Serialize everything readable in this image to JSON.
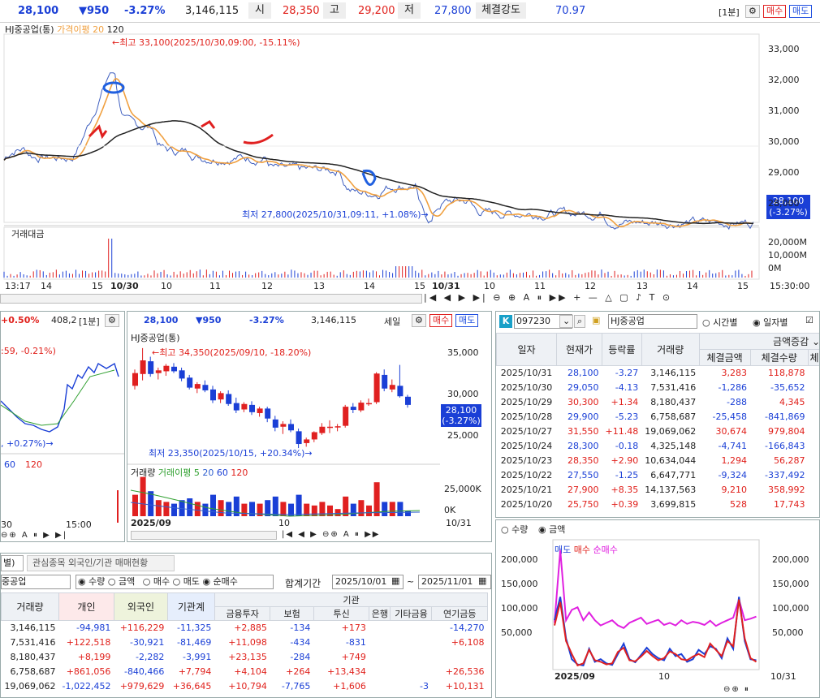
{
  "top": {
    "price": "28,100",
    "change": "▼950",
    "rate": "-3.27%",
    "volume": "3,146,115",
    "open_label": "시",
    "open": "28,350",
    "high_label": "고",
    "high": "29,200",
    "low_label": "저",
    "low": "27,800",
    "strength_label": "체결강도",
    "strength": "70.97",
    "interval": "[1분]",
    "sell": "매수",
    "buy": "매도"
  },
  "main_chart": {
    "title": "HJ중공업(통)",
    "ma_label": "가격이평",
    "ma1": "20",
    "ma2": "120",
    "high_annot": "←최고 33,100(2025/10/30,09:00, -15.11%)",
    "low_annot": "최저 27,800(2025/10/31,09:11, +1.08%)→",
    "price_box": "28,100",
    "price_box_pct": "(-3.27%)",
    "y_ticks": [
      "33,000",
      "32,000",
      "31,000",
      "30,000",
      "29,000",
      "28,000"
    ],
    "vol_title": "거래대금",
    "vol_ticks": [
      "20,000M",
      "10,000M",
      "0M"
    ],
    "x_ticks": [
      "13:17",
      "14",
      "15",
      "10/30",
      "10",
      "11",
      "12",
      "13",
      "14",
      "15",
      "10/31",
      "10",
      "11",
      "12",
      "13",
      "14",
      "15"
    ],
    "time_right": "15:30:00"
  },
  "mini_left": {
    "rate": "+0.50%",
    "value": "408,2",
    "interval": "[1분]",
    "annot1": ":59, -0.21%)",
    "annot2": ", +0.27%)→",
    "ticks": [
      "60",
      "120"
    ],
    "x_ticks": [
      "30",
      "15:00"
    ]
  },
  "daily_chart": {
    "price": "28,100",
    "change": "▼950",
    "rate": "-3.27%",
    "volume": "3,146,115",
    "period": "세일",
    "sell": "매수",
    "buy": "매도",
    "title": "HJ중공업(통)",
    "high_annot": "←최고 34,350(2025/09/10, -18.20%)",
    "low_annot": "최저 23,350(2025/10/15, +20.34%)→",
    "y_ticks": [
      "35,000",
      "30,000",
      "25,000"
    ],
    "price_box": "28,100",
    "price_box_pct": "(-3.27%)",
    "vol_title": "거래량",
    "vol_ma_label": "거래이평",
    "vol_ma": [
      "5",
      "20",
      "60",
      "120"
    ],
    "vol_ticks": [
      "25,000K",
      "0K"
    ],
    "x_left": "2025/09",
    "x_mid": "10",
    "x_right": "10/31"
  },
  "stock_panel": {
    "code": "097230",
    "name": "HJ중공업",
    "radio_time": "시간별",
    "radio_day": "일자별",
    "headers": [
      "일자",
      "현재가",
      "등락률",
      "거래량"
    ],
    "sub_header_top": "금액증감",
    "sub_headers": [
      "체결금액",
      "체결수량",
      "체"
    ],
    "rows": [
      [
        "2025/10/31",
        "28,100",
        "-3.27",
        "3,146,115",
        "3,283",
        "118,878"
      ],
      [
        "2025/10/30",
        "29,050",
        "-4.13",
        "7,531,416",
        "-1,286",
        "-35,652"
      ],
      [
        "2025/10/29",
        "30,300",
        "+1.34",
        "8,180,437",
        "-288",
        "4,345"
      ],
      [
        "2025/10/28",
        "29,900",
        "-5.23",
        "6,758,687",
        "-25,458",
        "-841,869"
      ],
      [
        "2025/10/27",
        "31,550",
        "+11.48",
        "19,069,062",
        "30,674",
        "979,804"
      ],
      [
        "2025/10/24",
        "28,300",
        "-0.18",
        "4,325,148",
        "-4,741",
        "-166,843"
      ],
      [
        "2025/10/23",
        "28,350",
        "+2.90",
        "10,634,044",
        "1,294",
        "56,287"
      ],
      [
        "2025/10/22",
        "27,550",
        "-1.25",
        "6,647,771",
        "-9,324",
        "-337,492"
      ],
      [
        "2025/10/21",
        "27,900",
        "+8.35",
        "14,137,563",
        "9,210",
        "358,992"
      ],
      [
        "2025/10/20",
        "25,750",
        "+0.39",
        "3,699,815",
        "528",
        "17,743"
      ]
    ]
  },
  "flow_chart": {
    "radio_qty": "수량",
    "radio_amt": "금액",
    "legend": [
      "매도",
      "매수",
      "순매수"
    ],
    "y_ticks": [
      "200,000",
      "150,000",
      "100,000",
      "50,000"
    ],
    "x_left": "2025/09",
    "x_mid": "10",
    "x_right": "10/31"
  },
  "investor": {
    "tab1": "별)",
    "tab2": "관심종목 외국인/기관 매매현황",
    "name": "중공업",
    "radios": [
      "수량",
      "금액",
      "매수",
      "매도",
      "순매수"
    ],
    "period_label": "합계기간",
    "date_from": "2025/10/01",
    "date_to": "2025/11/01",
    "group_header": "기관",
    "headers": [
      "거래량",
      "개인",
      "외국인",
      "기관계",
      "금융투자",
      "보험",
      "투신",
      "은행",
      "기타금융",
      "연기금등"
    ],
    "rows": [
      [
        "3,146,115",
        "-94,981",
        "+116,229",
        "-11,325",
        "+2,885",
        "-134",
        "+173",
        "",
        "",
        "-14,270"
      ],
      [
        "7,531,416",
        "+122,518",
        "-30,921",
        "-81,469",
        "+11,098",
        "-434",
        "-831",
        "",
        "",
        "+6,108"
      ],
      [
        "8,180,437",
        "+8,199",
        "-2,282",
        "-3,991",
        "+23,135",
        "-284",
        "+749",
        "",
        "",
        ""
      ],
      [
        "6,758,687",
        "+861,056",
        "-840,466",
        "+7,794",
        "+4,104",
        "+264",
        "+13,434",
        "",
        "",
        "+26,536"
      ],
      [
        "19,069,062",
        "-1,022,452",
        "+979,629",
        "+36,645",
        "+10,794",
        "-7,765",
        "+1,606",
        "",
        "-3",
        "+10,131"
      ]
    ]
  },
  "colors": {
    "up": "#e0201b",
    "down": "#1a3fd6",
    "ma20": "#f0a040",
    "ma120": "#222222",
    "bg": "#ffffff"
  }
}
